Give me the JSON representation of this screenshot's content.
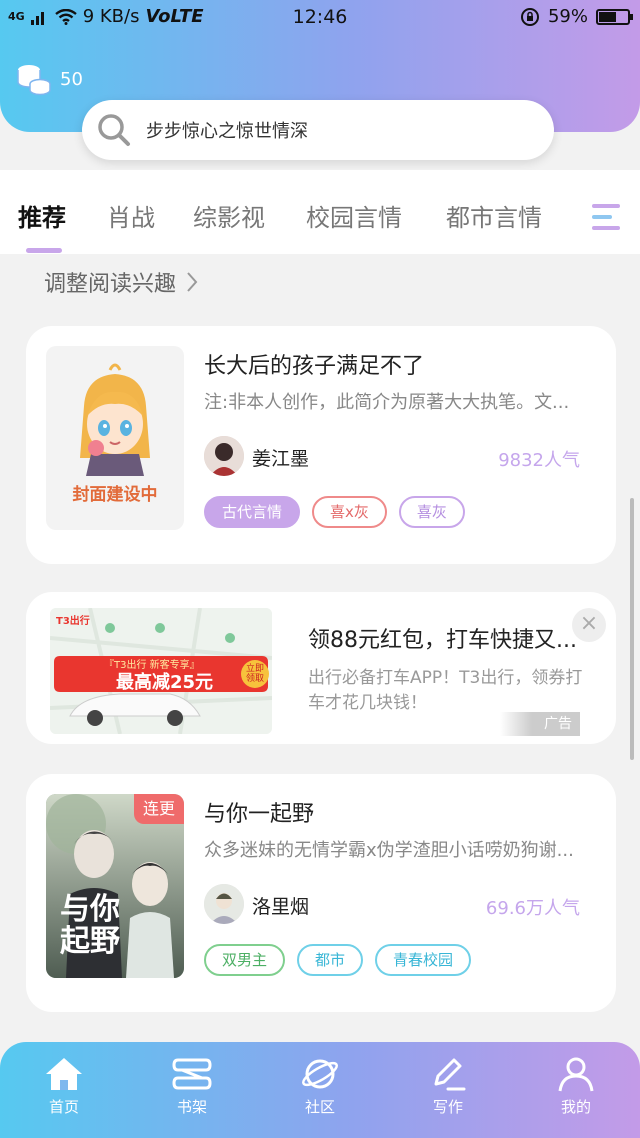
{
  "status_bar": {
    "network": "4G",
    "speed": "9 KB/s",
    "volte": "VoLTE",
    "time": "12:46",
    "battery": "59%",
    "battery_level": 0.59
  },
  "header": {
    "coin_count": "50",
    "search_placeholder": "步步惊心之惊世情深"
  },
  "tabs": [
    {
      "label": "推荐",
      "active": true
    },
    {
      "label": "肖战"
    },
    {
      "label": "综影视"
    },
    {
      "label": "校园言情"
    },
    {
      "label": "都市言情"
    }
  ],
  "interest_label": "调整阅读兴趣",
  "books": [
    {
      "title": "长大后的孩子满足不了",
      "desc": "注:非本人创作，此简介为原著大大执笔。文...",
      "author": "姜江墨",
      "popularity": "9832人气",
      "cover_text": "封面建设中",
      "tags": [
        {
          "label": "古代言情",
          "style": "filled"
        },
        {
          "label": "喜x灰",
          "style": "red"
        },
        {
          "label": "喜灰",
          "style": "purple"
        }
      ]
    },
    {
      "title": "与你一起野",
      "desc": "众多迷妹的无情学霸x伪学渣胆小话唠奶狗谢...",
      "author": "洛里烟",
      "popularity": "69.6万人气",
      "badge": "连更",
      "cover_text": "与你起野",
      "tags": [
        {
          "label": "双男主",
          "style": "green"
        },
        {
          "label": "都市",
          "style": "cyan"
        },
        {
          "label": "青春校园",
          "style": "cyan"
        }
      ]
    }
  ],
  "ad": {
    "title": "领88元红包，打车快捷又...",
    "desc": "出行必备打车APP！T3出行，领券打车才花几块钱！",
    "badge": "广告",
    "close": "×",
    "image_brand": "T3出行",
    "image_banner_top": "『T3出行 新客专享』",
    "image_banner_main": "最高减25元",
    "image_button": "立即领取"
  },
  "bottom_nav": [
    {
      "label": "首页",
      "icon": "home-icon"
    },
    {
      "label": "书架",
      "icon": "bookshelf-icon"
    },
    {
      "label": "社区",
      "icon": "planet-icon"
    },
    {
      "label": "写作",
      "icon": "pen-icon"
    },
    {
      "label": "我的",
      "icon": "user-icon"
    }
  ],
  "colors": {
    "accent_purple": "#c5a6ec",
    "gradient_start": "#56c9f0",
    "gradient_end": "#c39be8"
  }
}
